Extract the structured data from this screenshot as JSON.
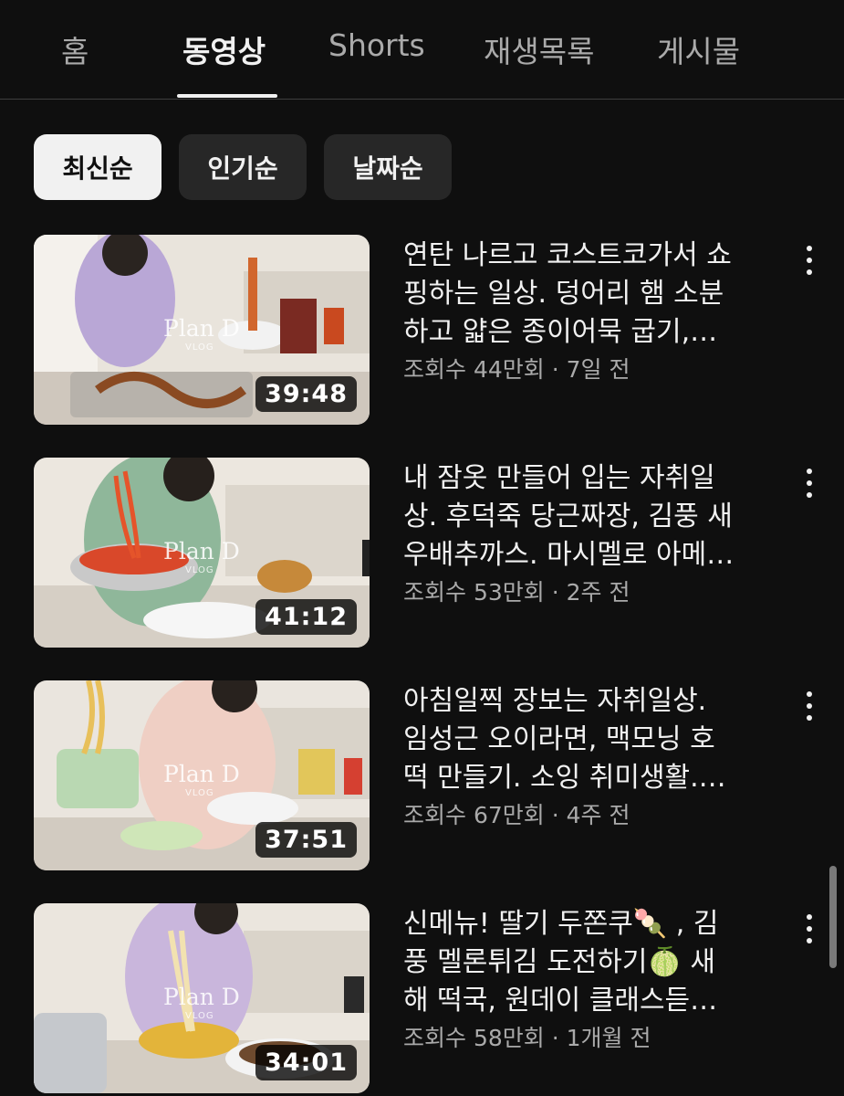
{
  "tabs": [
    {
      "label": "홈",
      "active": false
    },
    {
      "label": "동영상",
      "active": true
    },
    {
      "label": "Shorts",
      "active": false
    },
    {
      "label": "재생목록",
      "active": false
    },
    {
      "label": "게시물",
      "active": false
    }
  ],
  "chips": [
    {
      "label": "최신순",
      "selected": true
    },
    {
      "label": "인기순",
      "selected": false
    },
    {
      "label": "날짜순",
      "selected": false
    }
  ],
  "watermark": {
    "main": "Plan D",
    "sub": "VLOG"
  },
  "videos": [
    {
      "title_lines": [
        "연탄 나르고 코스트코가서 쇼",
        "핑하는 일상. 덩어리 햄 소분",
        "하고 얇은 종이어묵 굽기,…"
      ],
      "views": "조회수 44만회",
      "age": "7일 전",
      "duration": "39:48"
    },
    {
      "title_lines": [
        "내 잠옷 만들어 입는 자취일",
        "상. 후덕죽 당근짜장, 김풍 새",
        "우배추까스. 마시멜로 아메…"
      ],
      "views": "조회수 53만회",
      "age": "2주 전",
      "duration": "41:12"
    },
    {
      "title_lines": [
        "아침일찍 장보는 자취일상.",
        "임성근 오이라면, 맥모닝 호",
        "떡 만들기. 소잉 취미생활.…"
      ],
      "views": "조회수 67만회",
      "age": "4주 전",
      "duration": "37:51"
    },
    {
      "title_lines": [
        "신메뉴! 딸기 두쫀쿠🍡 , 김",
        "풍 멜론튀김 도전하기🍈 새",
        "해 떡국, 원데이 클래스듣…"
      ],
      "views": "조회수 58만회",
      "age": "1개월 전",
      "duration": "34:01"
    }
  ],
  "meta_separator": " · "
}
